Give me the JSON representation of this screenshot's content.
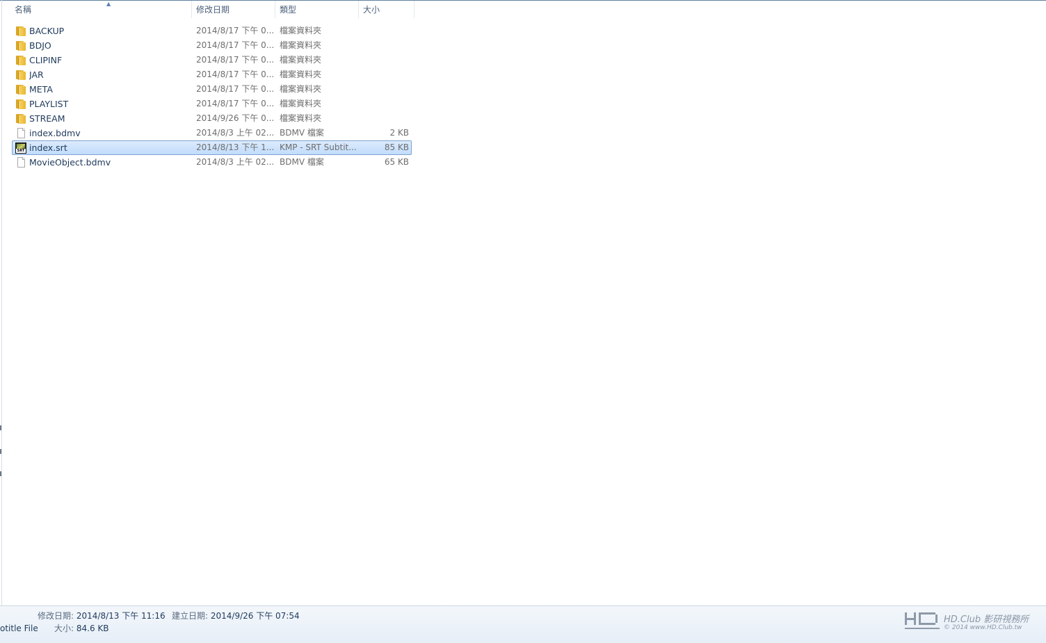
{
  "columns": {
    "name": "名稱",
    "date": "修改日期",
    "type": "類型",
    "size": "大小"
  },
  "files": [
    {
      "name": "BACKUP",
      "date": "2014/8/17 下午 0...",
      "type": "檔案資料夾",
      "size": "",
      "icon": "folder-icon"
    },
    {
      "name": "BDJO",
      "date": "2014/8/17 下午 0...",
      "type": "檔案資料夾",
      "size": "",
      "icon": "folder-icon"
    },
    {
      "name": "CLIPINF",
      "date": "2014/8/17 下午 0...",
      "type": "檔案資料夾",
      "size": "",
      "icon": "folder-icon"
    },
    {
      "name": "JAR",
      "date": "2014/8/17 下午 0...",
      "type": "檔案資料夾",
      "size": "",
      "icon": "folder-icon"
    },
    {
      "name": "META",
      "date": "2014/8/17 下午 0...",
      "type": "檔案資料夾",
      "size": "",
      "icon": "folder-icon"
    },
    {
      "name": "PLAYLIST",
      "date": "2014/8/17 下午 0...",
      "type": "檔案資料夾",
      "size": "",
      "icon": "folder-icon"
    },
    {
      "name": "STREAM",
      "date": "2014/9/26 下午 0...",
      "type": "檔案資料夾",
      "size": "",
      "icon": "folder-icon"
    },
    {
      "name": "index.bdmv",
      "date": "2014/8/3 上午 02...",
      "type": "BDMV 檔案",
      "size": "2 KB",
      "icon": "file-icon"
    },
    {
      "name": "index.srt",
      "date": "2014/8/13 下午 1...",
      "type": "KMP - SRT Subtit...",
      "size": "85 KB",
      "icon": "srt-file-icon",
      "selected": true
    },
    {
      "name": "MovieObject.bdmv",
      "date": "2014/8/3 上午 02...",
      "type": "BDMV 檔案",
      "size": "65 KB",
      "icon": "file-icon"
    }
  ],
  "srt_icon_label": "SRT",
  "status": {
    "modified_label": "修改日期:",
    "modified_value": "2014/8/13 下午 11:16",
    "created_label": "建立日期:",
    "created_value": "2014/9/26 下午 07:54",
    "type_text": "otitle File",
    "size_label": "大小:",
    "size_value": "84.6 KB"
  },
  "watermark": {
    "line1": "HD.Club 影研視務所",
    "line2": "© 2014  www.HD.Club.tw"
  }
}
